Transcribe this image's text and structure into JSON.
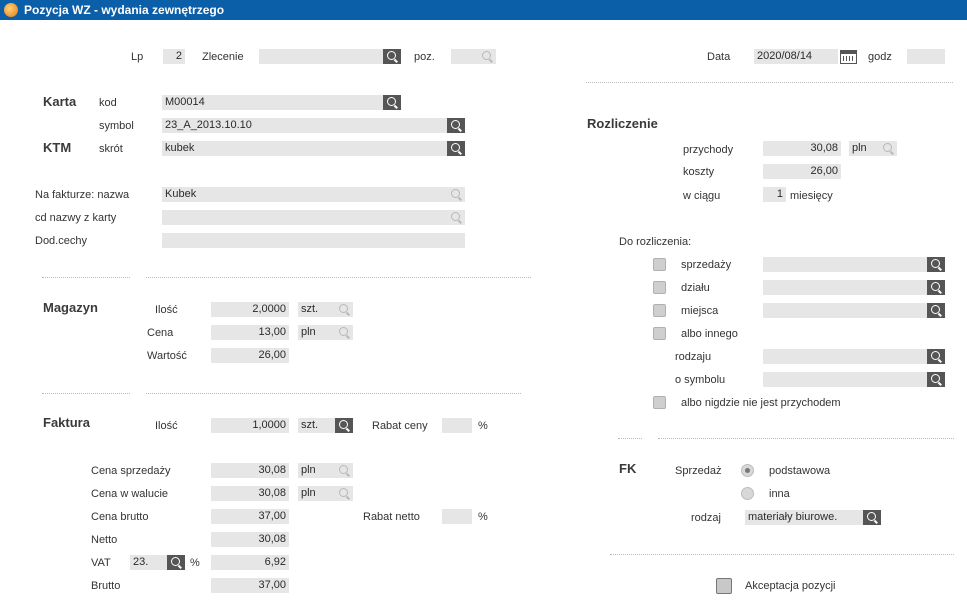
{
  "window": {
    "title": "Pozycja WZ - wydania zewnętrzego"
  },
  "header": {
    "lp_label": "Lp",
    "lp_value": "2",
    "zlecenie_label": "Zlecenie",
    "zlecenie_value": "",
    "poz_label": "poz.",
    "poz_value": "",
    "data_label": "Data",
    "data_value": "2020/08/14",
    "godz_label": "godz",
    "godz_value": ""
  },
  "karta": {
    "section": "Karta",
    "ktm_section": "KTM",
    "kod_label": "kod",
    "kod_value": "M00014",
    "symbol_label": "symbol",
    "symbol_value": "23_A_2013.10.10",
    "skrot_label": "skrót",
    "skrot_value": "kubek"
  },
  "faktura_name": {
    "nazwa_label": "Na fakturze: nazwa",
    "nazwa_value": "Kubek",
    "cd_label": "cd  nazwy z karty",
    "cd_value": "",
    "dod_label": "Dod.cechy",
    "dod_value": ""
  },
  "magazyn": {
    "section": "Magazyn",
    "ilosc_label": "Ilość",
    "ilosc_value": "2,0000",
    "ilosc_unit": "szt.",
    "cena_label": "Cena",
    "cena_value": "13,00",
    "cena_unit": "pln",
    "wartosc_label": "Wartość",
    "wartosc_value": "26,00"
  },
  "faktura": {
    "section": "Faktura",
    "ilosc_label": "Ilość",
    "ilosc_value": "1,0000",
    "ilosc_unit": "szt.",
    "rabat_ceny_label": "Rabat ceny",
    "rabat_ceny_value": "",
    "pct": "%",
    "cena_sprz_label": "Cena sprzedaży",
    "cena_sprz_value": "30,08",
    "cena_sprz_unit": "pln",
    "cena_wal_label": "Cena w walucie",
    "cena_wal_value": "30,08",
    "cena_wal_unit": "pln",
    "cena_brutto_label": "Cena brutto",
    "cena_brutto_value": "37,00",
    "rabat_netto_label": "Rabat netto",
    "rabat_netto_value": "",
    "netto_label": "Netto",
    "netto_value": "30,08",
    "vat_label": "VAT",
    "vat_rate": "23.",
    "vat_value": "6,92",
    "brutto_label": "Brutto",
    "brutto_value": "37,00"
  },
  "rozliczenie": {
    "section": "Rozliczenie",
    "przychody_label": "przychody",
    "przychody_value": "30,08",
    "przychody_unit": "pln",
    "koszty_label": "koszty",
    "koszty_value": "26,00",
    "wciagu_label": "w ciągu",
    "wciagu_value": "1",
    "miesiecy_label": "miesięcy",
    "do_rozl_label": "Do rozliczenia:",
    "sprzedazy_label": "sprzedaży",
    "dzialu_label": "działu",
    "miejsca_label": "miejsca",
    "albo_innego_label": "albo innego",
    "rodzaju_label": "rodzaju",
    "o_symbolu_label": "o symbolu",
    "albo_nigdzie_label": "albo nigdzie nie jest przychodem"
  },
  "fk": {
    "section": "FK",
    "sprzedaz_label": "Sprzedaż",
    "podstawowa_label": "podstawowa",
    "inna_label": "inna",
    "rodzaj_label": "rodzaj",
    "rodzaj_value": "materiały  biurowe."
  },
  "akceptacja_label": "Akceptacja pozycji"
}
